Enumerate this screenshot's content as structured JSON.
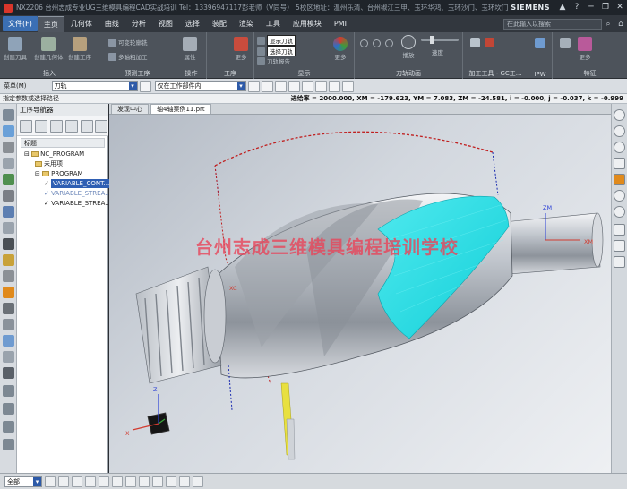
{
  "titlebar": {
    "text": "NX2206 台州志成专业UG三维模具编程CAD实战培训  Tel：13396947117彭老师（V同号） 5校区地址：温州乐清、台州椒江三甲、玉环华鸿、玉环沙门、玉环坎门 · 加工",
    "brand": "SIEMENS",
    "buttons": [
      "▲",
      "?",
      "─",
      "❐",
      "✕"
    ]
  },
  "menubar": {
    "file": "文件(F)",
    "tabs": [
      "主页",
      "几何体",
      "曲线",
      "分析",
      "视图",
      "选择",
      "装配",
      "渲染",
      "工具",
      "应用模块",
      "PMI"
    ],
    "active_tab": "主页",
    "search_placeholder": "在此输入以搜索"
  },
  "ribbon": {
    "groups": [
      {
        "label": "插入",
        "buttons": [
          "创建刀具",
          "创建几何体",
          "创建工序"
        ]
      },
      {
        "label": "预测工序",
        "buttons": [
          "可变轮廓铣",
          "多轴粗加工"
        ]
      },
      {
        "label": "操作",
        "buttons": [
          "属性"
        ]
      },
      {
        "label": "工序",
        "buttons": [
          "更多"
        ]
      },
      {
        "label": "显示",
        "buttons": [
          "显示刀轨",
          "选择刀轨",
          "刀轨报告",
          "更多"
        ]
      },
      {
        "label": "刀轨动画",
        "buttons": [
          "播放",
          "速度"
        ]
      },
      {
        "label": "加工工具 - GC工...",
        "buttons": []
      },
      {
        "label": "IPW",
        "buttons": []
      },
      {
        "label": "特征",
        "buttons": [
          "更多"
        ]
      }
    ]
  },
  "cmdbar": {
    "menu": "菜单(M)",
    "filter": "刀轨",
    "scope": "仅在工作部件内"
  },
  "statusbar": {
    "prompt": "指定参数或选择路径",
    "readout": "进给率 = 2000.000, XM = -179.623, YM = 7.083, ZM = -24.581, i = -0.000, j = -0.037, k = -0.999"
  },
  "navigator": {
    "title": "工序导航器",
    "column": "标题",
    "items": [
      {
        "label": "NC_PROGRAM",
        "level": 0
      },
      {
        "label": "未用项",
        "level": 1
      },
      {
        "label": "PROGRAM",
        "level": 1
      },
      {
        "label": "VARIABLE_CONT...",
        "level": 2,
        "selected": true
      },
      {
        "label": "VARIABLE_STREA...",
        "level": 2,
        "gray": true
      },
      {
        "label": "VARIABLE_STREA...",
        "level": 2
      }
    ]
  },
  "viewport": {
    "tabs": [
      "发现中心",
      "轴4轴案例11.prt"
    ],
    "active_tab": "轴4轴案例11.prt",
    "watermark": "台州志成三维模具编程培训学校",
    "csys_labels": [
      "ZM",
      "XM",
      "XC"
    ],
    "triad_labels": [
      "Z",
      "X"
    ]
  },
  "bottombar": {
    "filter": "全部"
  },
  "colors": {
    "accent": "#3b6fb4",
    "toolpath": "#19e6e6",
    "watermark": "#e8455a",
    "tool": "#e8e040"
  }
}
